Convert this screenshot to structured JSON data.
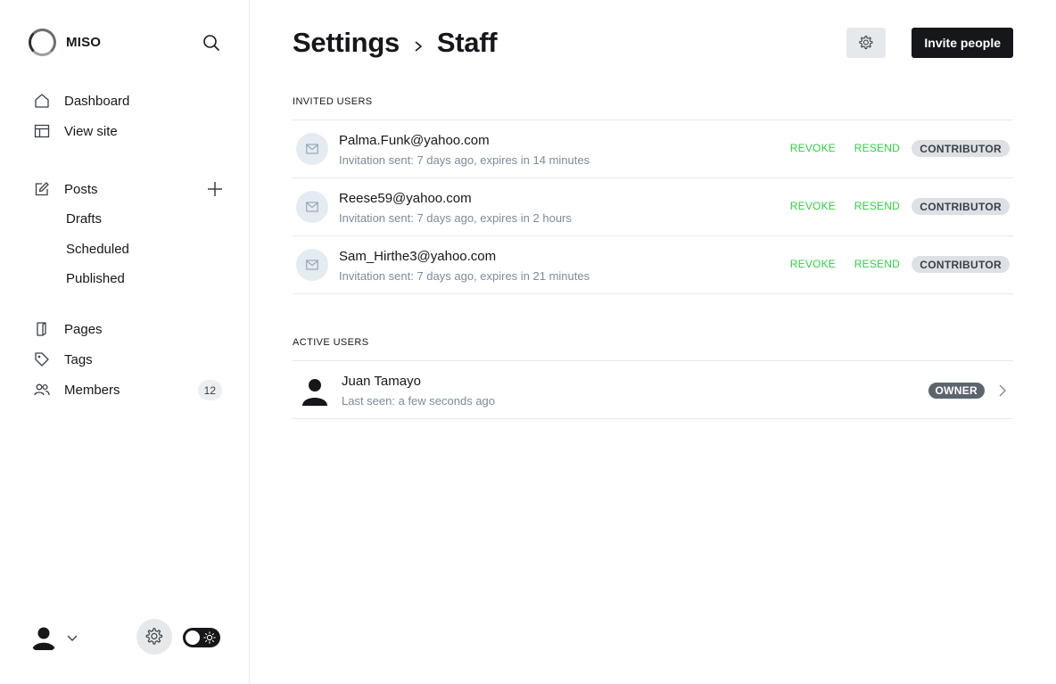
{
  "brand": {
    "name": "MISO"
  },
  "sidebar": {
    "nav": [
      {
        "label": "Dashboard",
        "icon": "home-icon"
      },
      {
        "label": "View site",
        "icon": "layout-icon"
      }
    ],
    "posts": {
      "label": "Posts",
      "icon": "pencil-icon",
      "sub": [
        "Drafts",
        "Scheduled",
        "Published"
      ]
    },
    "lower": [
      {
        "label": "Pages",
        "icon": "page-icon"
      },
      {
        "label": "Tags",
        "icon": "tag-icon"
      },
      {
        "label": "Members",
        "icon": "members-icon",
        "count": "12"
      }
    ]
  },
  "header": {
    "breadcrumb_parent": "Settings",
    "breadcrumb_current": "Staff",
    "invite_label": "Invite people"
  },
  "invited": {
    "section_title": "INVITED USERS",
    "revoke_label": "REVOKE",
    "resend_label": "RESEND",
    "users": [
      {
        "email": "Palma.Funk@yahoo.com",
        "meta": "Invitation sent: 7 days ago, expires in 14 minutes",
        "role": "CONTRIBUTOR"
      },
      {
        "email": "Reese59@yahoo.com",
        "meta": "Invitation sent: 7 days ago, expires in 2 hours",
        "role": "CONTRIBUTOR"
      },
      {
        "email": "Sam_Hirthe3@yahoo.com",
        "meta": "Invitation sent: 7 days ago, expires in 21 minutes",
        "role": "CONTRIBUTOR"
      }
    ]
  },
  "active": {
    "section_title": "ACTIVE USERS",
    "users": [
      {
        "name": "Juan Tamayo",
        "meta": "Last seen: a few seconds ago",
        "role": "OWNER"
      }
    ]
  },
  "colors": {
    "accent_green": "#30cf43",
    "dark": "#15171a",
    "muted": "#7c8b9a"
  }
}
